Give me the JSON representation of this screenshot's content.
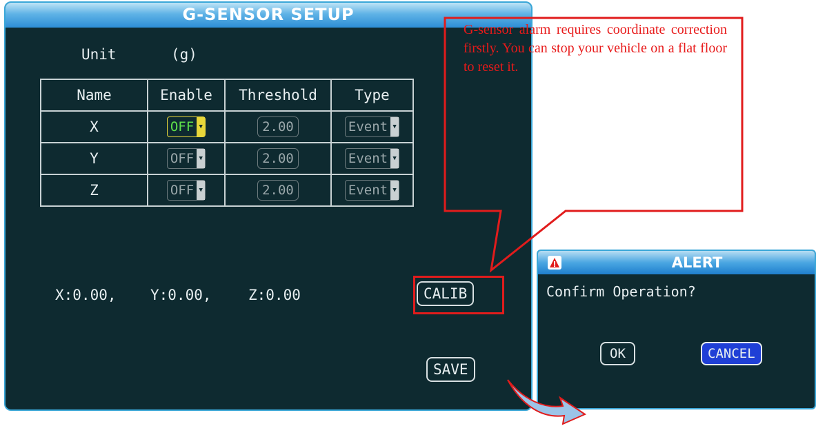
{
  "panel": {
    "title": "G-SENSOR SETUP",
    "unit_label": "Unit",
    "unit_value": "(g)",
    "columns": [
      "Name",
      "Enable",
      "Threshold",
      "Type"
    ],
    "rows": [
      {
        "name": "X",
        "enable": "OFF",
        "threshold": "2.00",
        "type": "Event"
      },
      {
        "name": "Y",
        "enable": "OFF",
        "threshold": "2.00",
        "type": "Event"
      },
      {
        "name": "Z",
        "enable": "OFF",
        "threshold": "2.00",
        "type": "Event"
      }
    ],
    "readout": {
      "x": "X:0.00,",
      "y": "Y:0.00,",
      "z": "Z:0.00"
    },
    "calib_label": "CALIB",
    "save_label": "SAVE"
  },
  "annotation": {
    "note": "G-sensor alarm requires coordinate correction firstly. You can stop your vehicle on a flat floor to reset it."
  },
  "alert": {
    "title": "ALERT",
    "message": "Confirm Operation?",
    "ok_label": "OK",
    "cancel_label": "CANCEL"
  },
  "colors": {
    "panel_bg": "#0e2a30",
    "title_blue": "#2d8ed6",
    "highlight_red": "#e11c1c",
    "active_yellow": "#e8d73a",
    "active_green": "#5ee14a",
    "cancel_blue": "#1f3fd6",
    "arrow_blue": "#9cc4e8"
  },
  "icons": [
    "dropdown-arrow-icon",
    "warning-icon",
    "callout-arrow-icon"
  ]
}
